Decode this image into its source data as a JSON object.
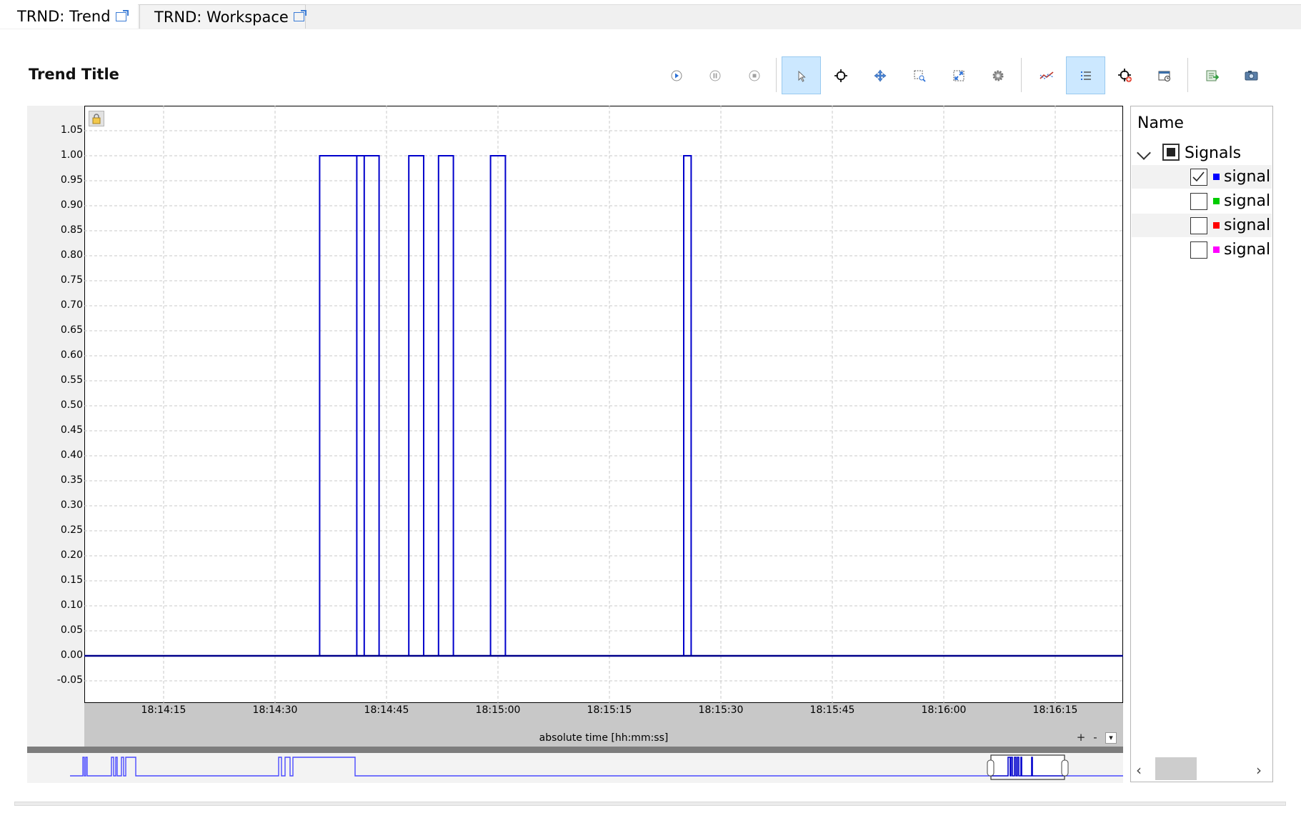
{
  "tabs": [
    {
      "label": "TRND: Trend",
      "active": true
    },
    {
      "label": "TRND: Workspace",
      "active": false
    }
  ],
  "trend": {
    "title": "Trend Title"
  },
  "toolbar": {
    "groups": [
      [
        "play-icon",
        "pause-icon",
        "stop-icon"
      ],
      [
        "pointer-icon",
        "crosshair-icon",
        "pan-icon",
        "zoom-box-icon",
        "zoom-fit-icon",
        "settings-icon"
      ],
      [
        "line-style-icon",
        "legend-list-icon",
        "add-cursor-icon",
        "window-icon"
      ],
      [
        "export-icon",
        "camera-icon"
      ]
    ],
    "selected": [
      "pointer-icon",
      "legend-list-icon"
    ]
  },
  "colors": {
    "signal_line": "#0000cc",
    "overview_line": "#4a4aff",
    "sig1": "#0000ff",
    "sig2": "#00cc00",
    "sig3": "#ff0000",
    "sig4": "#ff00ff"
  },
  "chart_data": {
    "type": "line",
    "title": "Trend Title",
    "xlabel": "absolute time [hh:mm:ss]",
    "ylabel": "",
    "y_ticks": [
      "1.05",
      "1.00",
      "0.95",
      "0.90",
      "0.85",
      "0.80",
      "0.75",
      "0.70",
      "0.65",
      "0.60",
      "0.55",
      "0.50",
      "0.45",
      "0.40",
      "0.35",
      "0.30",
      "0.25",
      "0.20",
      "0.15",
      "0.10",
      "0.05",
      "0.00",
      "-0.05"
    ],
    "x_ticks": [
      "18:14:15",
      "18:14:30",
      "18:14:45",
      "18:15:00",
      "18:15:15",
      "18:15:30",
      "18:15:45",
      "18:16:00",
      "18:16:15"
    ],
    "ylim": [
      -0.1,
      1.1
    ],
    "grid": true,
    "series": [
      {
        "name": "signal",
        "step": true,
        "points": [
          [
            "18:14:04",
            0
          ],
          [
            "18:14:36",
            0
          ],
          [
            "18:14:36",
            1
          ],
          [
            "18:14:41",
            1
          ],
          [
            "18:14:41",
            0
          ],
          [
            "18:14:41",
            1
          ],
          [
            "18:14:42",
            1
          ],
          [
            "18:14:42",
            0
          ],
          [
            "18:14:42",
            1
          ],
          [
            "18:14:44",
            1
          ],
          [
            "18:14:44",
            0
          ],
          [
            "18:14:48",
            0
          ],
          [
            "18:14:48",
            1
          ],
          [
            "18:14:50",
            1
          ],
          [
            "18:14:50",
            0
          ],
          [
            "18:14:52",
            0
          ],
          [
            "18:14:52",
            1
          ],
          [
            "18:14:54",
            1
          ],
          [
            "18:14:54",
            0
          ],
          [
            "18:14:59",
            0
          ],
          [
            "18:14:59",
            1
          ],
          [
            "18:15:01",
            1
          ],
          [
            "18:15:01",
            0
          ],
          [
            "18:15:25",
            0
          ],
          [
            "18:15:25",
            1
          ],
          [
            "18:15:26",
            1
          ],
          [
            "18:15:26",
            0
          ],
          [
            "18:16:24",
            0
          ]
        ]
      }
    ]
  },
  "legend": {
    "header": "Name",
    "group": "Signals",
    "items": [
      {
        "label": "signal",
        "checked": true,
        "color": "#0000ff"
      },
      {
        "label": "signal",
        "checked": false,
        "color": "#00cc00"
      },
      {
        "label": "signal",
        "checked": false,
        "color": "#ff0000"
      },
      {
        "label": "signal",
        "checked": false,
        "color": "#ff00ff"
      }
    ]
  },
  "axis_controls": {
    "zoom_in": "+",
    "zoom_out": "-",
    "menu": "▾"
  }
}
